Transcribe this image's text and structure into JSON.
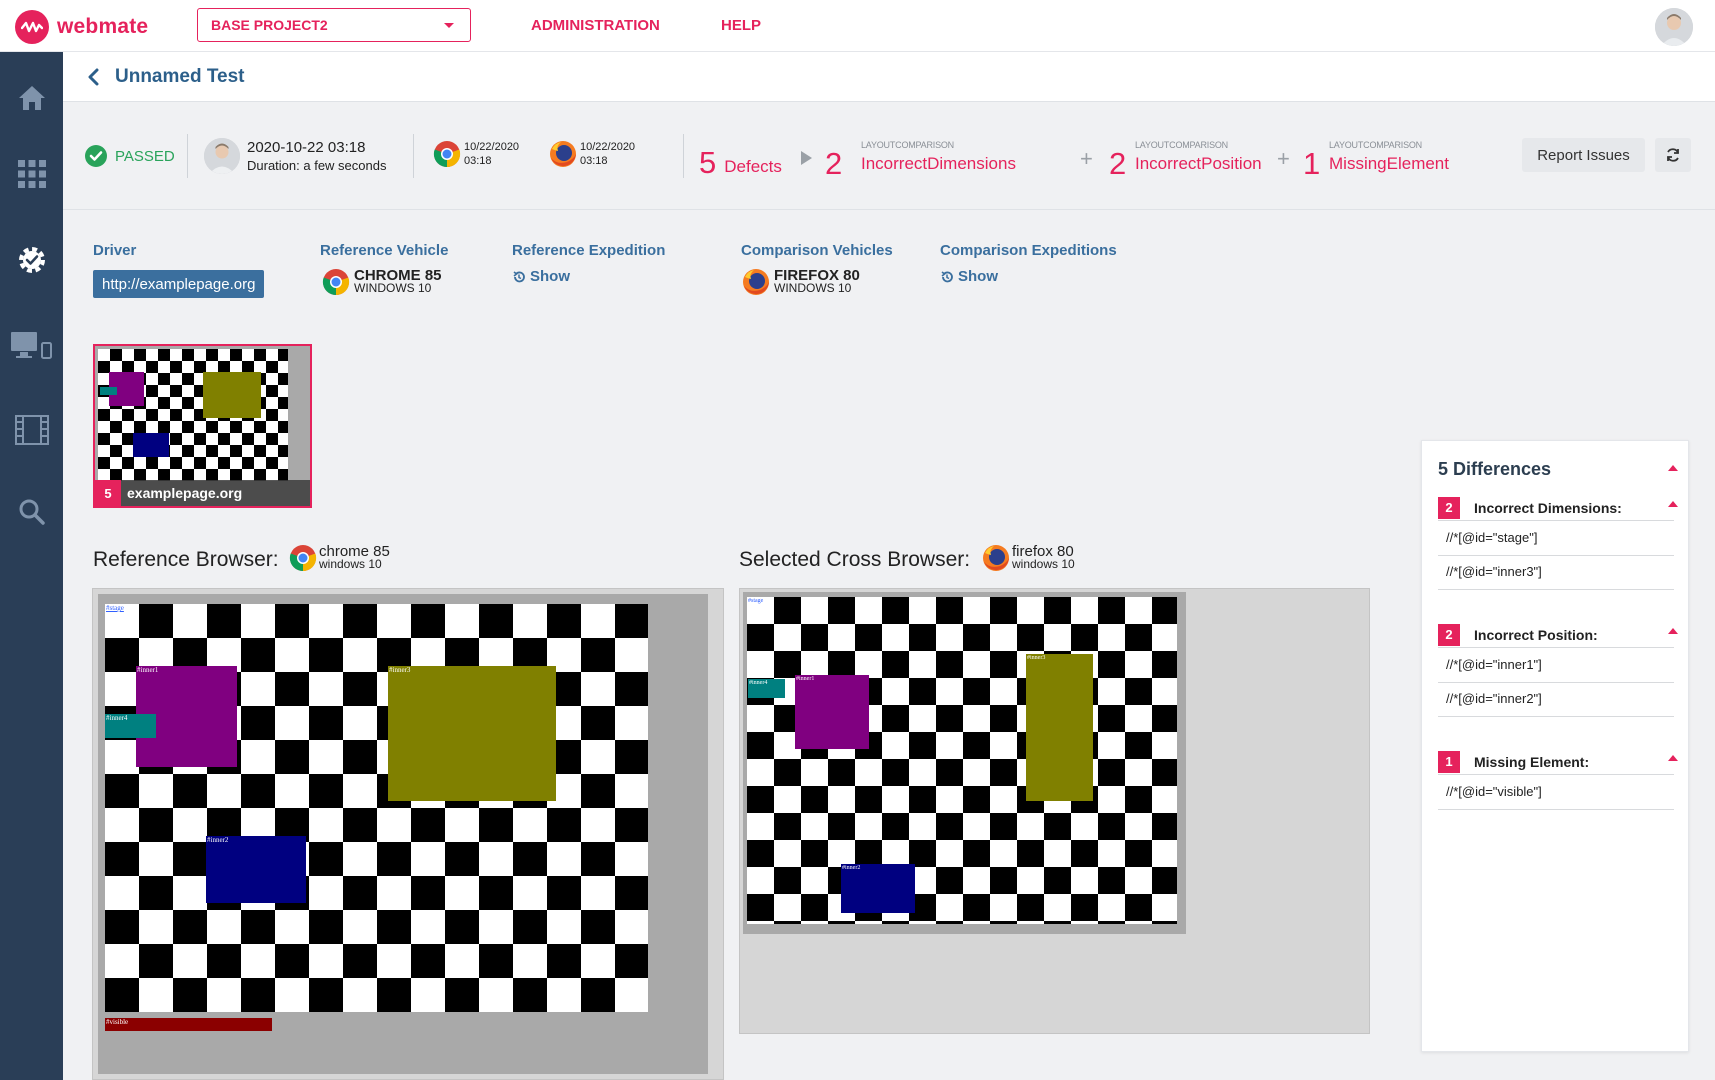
{
  "app": {
    "name": "webmate",
    "brand_color": "#e5225c"
  },
  "topbar": {
    "project": "BASE PROJECT2",
    "nav": [
      "ADMINISTRATION",
      "HELP"
    ]
  },
  "sidebar": {
    "items": [
      {
        "icon": "home-icon"
      },
      {
        "icon": "grid-icon"
      },
      {
        "icon": "gear-icon",
        "active": true
      },
      {
        "icon": "devices-icon"
      },
      {
        "icon": "film-icon"
      },
      {
        "icon": "search-icon"
      }
    ]
  },
  "page": {
    "title": "Unnamed Test"
  },
  "summary": {
    "status": "PASSED",
    "run_time": "2020-10-22 03:18",
    "duration": "Duration: a few seconds",
    "browsers": [
      {
        "icon": "chrome-icon",
        "date": "10/22/2020",
        "time": "03:18"
      },
      {
        "icon": "firefox-icon",
        "date": "10/22/2020",
        "time": "03:18"
      }
    ],
    "defects_count": "5",
    "defects_label": "Defects",
    "groups": [
      {
        "category": "LAYOUTCOMPARISON",
        "count": "2",
        "name": "IncorrectDimensions"
      },
      {
        "category": "LAYOUTCOMPARISON",
        "count": "2",
        "name": "IncorrectPosition"
      },
      {
        "category": "LAYOUTCOMPARISON",
        "count": "1",
        "name": "MissingElement"
      }
    ],
    "report_button": "Report Issues"
  },
  "info": {
    "driver_label": "Driver",
    "driver_value": "http://examplepage.org",
    "reference_vehicle_label": "Reference Vehicle",
    "reference_vehicle": {
      "name": "CHROME 85",
      "os": "WINDOWS 10"
    },
    "reference_expedition_label": "Reference Expedition",
    "reference_expedition_link": "Show",
    "comparison_vehicles_label": "Comparison Vehicles",
    "comparison_vehicle": {
      "name": "FIREFOX 80",
      "os": "WINDOWS 10"
    },
    "comparison_expeditions_label": "Comparison Expeditions",
    "comparison_expeditions_link": "Show"
  },
  "thumbnail": {
    "count": "5",
    "label": "examplepage.org"
  },
  "reference_browser": {
    "heading": "Reference Browser:",
    "name": "chrome 85",
    "os": "windows 10"
  },
  "cross_browser": {
    "heading": "Selected Cross Browser:",
    "name": "firefox 80",
    "os": "windows 10"
  },
  "elements": {
    "stage": "#stage",
    "inner1": "#inner1",
    "inner2": "#inner2",
    "inner3": "#inner3",
    "inner4": "#inner4",
    "visible": "#visible"
  },
  "colors": {
    "inner1": "#800080",
    "inner2": "#000080",
    "inner3": "#808000",
    "inner4": "#008080",
    "visible": "#8b0000"
  },
  "differences": {
    "title": "5 Differences",
    "groups": [
      {
        "count": "2",
        "name": "Incorrect Dimensions:",
        "items": [
          "//*[@id=\"stage\"]",
          "//*[@id=\"inner3\"]"
        ]
      },
      {
        "count": "2",
        "name": "Incorrect Position:",
        "items": [
          "//*[@id=\"inner1\"]",
          "//*[@id=\"inner2\"]"
        ]
      },
      {
        "count": "1",
        "name": "Missing Element:",
        "items": [
          "//*[@id=\"visible\"]"
        ]
      }
    ]
  }
}
